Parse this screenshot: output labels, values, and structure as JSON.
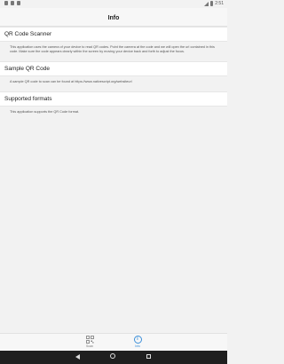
{
  "status_bar": {
    "time": "2:51"
  },
  "app_bar": {
    "title": "Info"
  },
  "sections": [
    {
      "heading": "QR Code Scanner",
      "body": "This application uses the camera of your device to read QR codes. Point the camera at the code and we will open the url contained in this code. Make sure the code appears clearly within the screen by moving your device back and forth to adjust the focus."
    },
    {
      "heading": "Sample QR Code",
      "body": "A sample QR code to scan can be found at https://www.nativescript.org/websiteurl"
    },
    {
      "heading": "Supported formats",
      "body": "This application supports the QR Code format."
    }
  ],
  "tabs": [
    {
      "label": "Scan",
      "icon": "qr-code-icon",
      "active": false
    },
    {
      "label": "Info",
      "icon": "info-icon",
      "active": true
    }
  ],
  "colors": {
    "accent": "#3b8fd9",
    "nav_bar": "#1f1f1f",
    "background": "#f2f2f2"
  }
}
